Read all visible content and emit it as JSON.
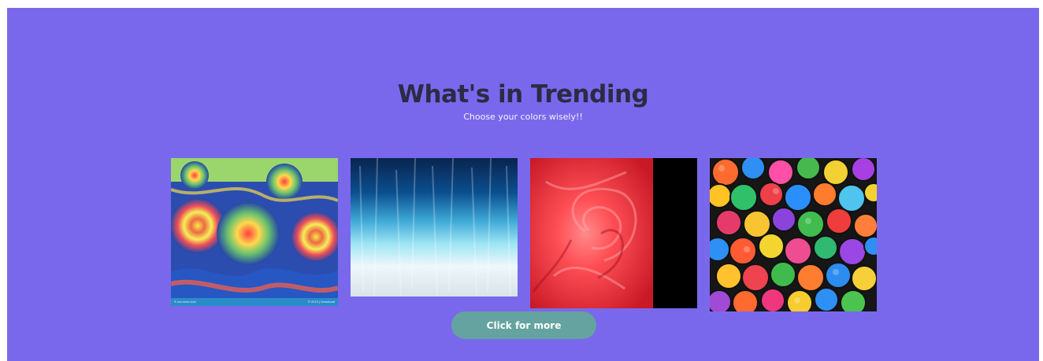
{
  "section": {
    "title": "What's in Trending",
    "subtitle": "Choose your colors wisely!!"
  },
  "cards": [
    {
      "name": "tie-dye fabric image",
      "caption_left": "© xxx.xxxx.com",
      "caption_right": "© 2013 | Download"
    },
    {
      "name": "dip-dye blue fabric image"
    },
    {
      "name": "red fabric image"
    },
    {
      "name": "colorful rolled fabrics image"
    }
  ],
  "button": {
    "label": "Click for more"
  },
  "colors": {
    "background": "#7a68ec",
    "title": "#2d2a45",
    "button": "#64a39f"
  }
}
